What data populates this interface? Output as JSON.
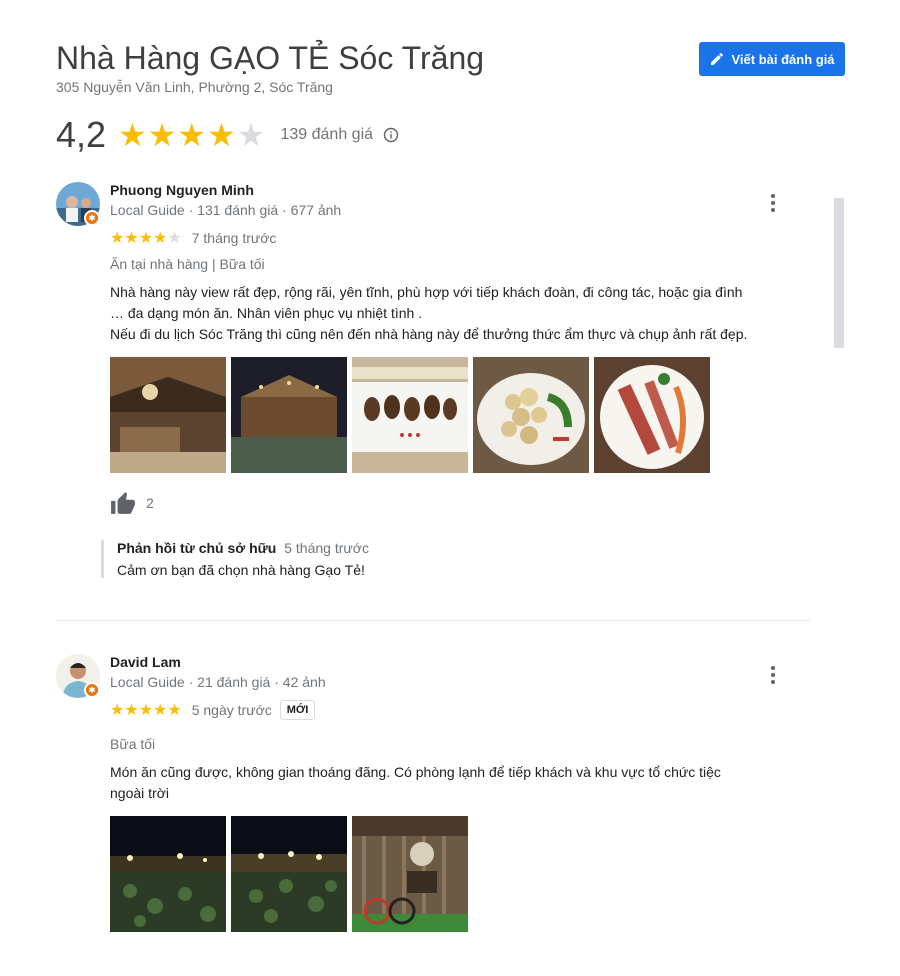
{
  "place": {
    "name": "Nhà Hàng GẠO TẺ Sóc Trăng",
    "address": "305 Nguyễn Văn Linh, Phường 2, Sóc Trăng",
    "write_review_label": "Viết bài đánh giá",
    "rating": "4,2",
    "rating_value": 4.2,
    "review_count": "139 đánh giá"
  },
  "reviews": [
    {
      "name": "Phuong Nguyen Minh",
      "meta": "Local Guide · 131 đánh giá · 677 ảnh",
      "stars": 4,
      "time": "7 tháng trước",
      "tags": "Ăn tại nhà hàng  |  Bữa tối",
      "text_lines": [
        "Nhà hàng này view rất đẹp, rộng rãi, yên tĩnh, phù hợp với tiếp khách đoàn, đi công tác, hoặc gia đình",
        "… đa dạng món ăn. Nhân viên phục vụ nhiệt tình .",
        "Nếu đi du lịch Sóc Trăng thì cũng nên đến nhà hàng này để thưởng thức ẩm thực và chụp ảnh rất đẹp."
      ],
      "likes": "2",
      "owner_reply": {
        "title": "Phản hồi từ chủ sở hữu",
        "time": "5 tháng trước",
        "text": "Cảm ơn bạn đã chọn nhà hàng Gạo Tẻ!"
      }
    },
    {
      "name": "David Lam",
      "meta": "Local Guide · 21 đánh giá · 42 ảnh",
      "stars": 5,
      "time": "5 ngày trước",
      "badge": "MỚI",
      "tags": "Bữa tối",
      "text_lines": [
        "Món ăn cũng được, không gian thoáng đãng. Có phòng lạnh để tiếp khách và khu vực tổ chức tiệc",
        "ngoài trời"
      ]
    }
  ],
  "colors": {
    "accent": "#1a73e8",
    "star": "#fbbc04",
    "star_empty": "#dadce0",
    "guide_badge": "#e8710a"
  },
  "icons": [
    "pencil-icon",
    "info-icon",
    "more-vert-icon",
    "thumb-up-icon",
    "local-guide-badge-icon"
  ]
}
